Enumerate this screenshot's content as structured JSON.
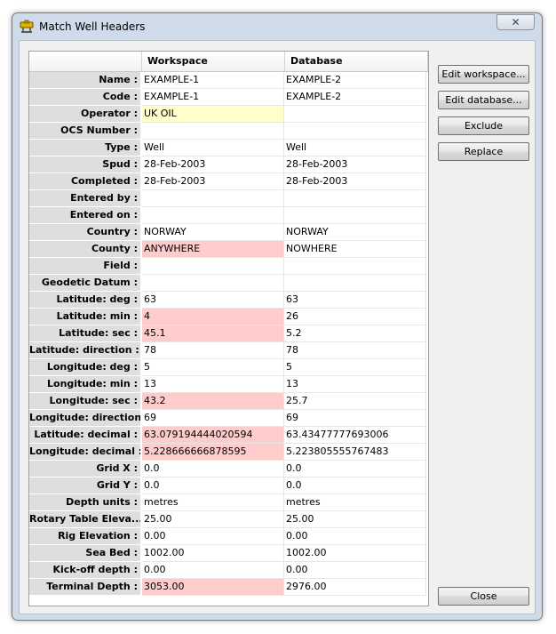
{
  "window": {
    "title": "Match Well Headers",
    "icon": "wellhead-app-icon",
    "close_glyph": "✕"
  },
  "table": {
    "headers": {
      "workspace": "Workspace",
      "database": "Database"
    },
    "rows": [
      {
        "label": "Name :",
        "workspace": "EXAMPLE-1",
        "database": "EXAMPLE-2",
        "hl": ""
      },
      {
        "label": "Code :",
        "workspace": "EXAMPLE-1",
        "database": "EXAMPLE-2",
        "hl": ""
      },
      {
        "label": "Operator :",
        "workspace": "UK OIL",
        "database": "",
        "hl": "yellow"
      },
      {
        "label": "OCS Number :",
        "workspace": "",
        "database": "",
        "hl": ""
      },
      {
        "label": "Type :",
        "workspace": "Well",
        "database": "Well",
        "hl": ""
      },
      {
        "label": "Spud :",
        "workspace": "28-Feb-2003",
        "database": "28-Feb-2003",
        "hl": ""
      },
      {
        "label": "Completed :",
        "workspace": "28-Feb-2003",
        "database": "28-Feb-2003",
        "hl": ""
      },
      {
        "label": "Entered by :",
        "workspace": "",
        "database": "",
        "hl": ""
      },
      {
        "label": "Entered on :",
        "workspace": "",
        "database": "",
        "hl": ""
      },
      {
        "label": "Country :",
        "workspace": "NORWAY",
        "database": "NORWAY",
        "hl": ""
      },
      {
        "label": "County :",
        "workspace": "ANYWHERE",
        "database": "NOWHERE",
        "hl": "red"
      },
      {
        "label": "Field :",
        "workspace": "",
        "database": "",
        "hl": ""
      },
      {
        "label": "Geodetic Datum :",
        "workspace": "",
        "database": "",
        "hl": ""
      },
      {
        "label": "Latitude: deg :",
        "workspace": "63",
        "database": "63",
        "hl": ""
      },
      {
        "label": "Latitude: min :",
        "workspace": "4",
        "database": "26",
        "hl": "red"
      },
      {
        "label": "Latitude: sec :",
        "workspace": "45.1",
        "database": "5.2",
        "hl": "red"
      },
      {
        "label": "Latitude: direction :",
        "workspace": "78",
        "database": "78",
        "hl": ""
      },
      {
        "label": "Longitude: deg :",
        "workspace": "5",
        "database": "5",
        "hl": ""
      },
      {
        "label": "Longitude: min :",
        "workspace": "13",
        "database": "13",
        "hl": ""
      },
      {
        "label": "Longitude: sec :",
        "workspace": "43.2",
        "database": "25.7",
        "hl": "red"
      },
      {
        "label": "Longitude: direction :",
        "workspace": "69",
        "database": "69",
        "hl": ""
      },
      {
        "label": "Latitude: decimal :",
        "workspace": "63.079194444020594",
        "database": "63.43477777693006",
        "hl": "red"
      },
      {
        "label": "Longitude: decimal :",
        "workspace": "5.228666666878595",
        "database": "5.223805555767483",
        "hl": "red"
      },
      {
        "label": "Grid X :",
        "workspace": "0.0",
        "database": "0.0",
        "hl": ""
      },
      {
        "label": "Grid Y :",
        "workspace": "0.0",
        "database": "0.0",
        "hl": ""
      },
      {
        "label": "Depth units :",
        "workspace": "metres",
        "database": "metres",
        "hl": ""
      },
      {
        "label": "Rotary Table Eleva...",
        "workspace": "25.00",
        "database": "25.00",
        "hl": ""
      },
      {
        "label": "Rig Elevation :",
        "workspace": "0.00",
        "database": "0.00",
        "hl": ""
      },
      {
        "label": "Sea Bed :",
        "workspace": "1002.00",
        "database": "1002.00",
        "hl": ""
      },
      {
        "label": "Kick-off depth :",
        "workspace": "0.00",
        "database": "0.00",
        "hl": ""
      },
      {
        "label": "Terminal Depth :",
        "workspace": "3053.00",
        "database": "2976.00",
        "hl": "red"
      }
    ]
  },
  "buttons": {
    "edit_workspace": "Edit workspace...",
    "edit_database": "Edit database...",
    "exclude": "Exclude",
    "replace": "Replace",
    "close": "Close"
  },
  "colors": {
    "mismatch": "#ffcccc",
    "partial": "#ffffcc",
    "label_bg": "#dedede"
  }
}
